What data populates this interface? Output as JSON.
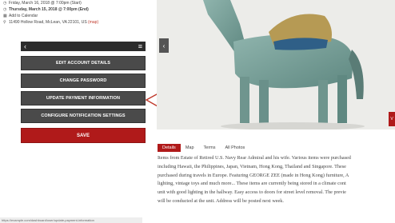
{
  "event": {
    "line1": "Friday, March 16, 2018 @ 7:00pm (Start)",
    "line2": "Thursday, March 15, 2018 @ 7:00pm (End)",
    "calendar_label": "Add to Calendar",
    "address": "11490 Hollow Road, McLean, VA 22101, US",
    "map_label": "(map)"
  },
  "menu": {
    "back_icon": "‹",
    "hamburger_icon": "≡",
    "edit_label": "EDIT ACCOUNT DETAILS",
    "password_label": "CHANGE PASSWORD",
    "payment_label": "UPDATE PAYMENT INFORMATION",
    "notifications_label": "CONFIGURE NOTIFICATION SETTINGS",
    "save_label": "SAVE"
  },
  "status_url": "https://example.com/dashboard/user/update-payment-information",
  "gallery": {
    "prev_icon": "‹",
    "next_label": "V"
  },
  "tabs": [
    "Details",
    "Map",
    "Terms",
    "All Photos"
  ],
  "details": {
    "lines": [
      "Items from Estate of Retired U.S. Navy Rear Admiral and his wife.  Various items were purchased",
      "including Hawaii, the Philippines, Japan, Vietnam, Hong Kong, Thailand and Singapore. These",
      "purchased during travels in Europe. Featuring GEORGE ZEE (made in Hong Kong) furniture, A",
      "lighting, vintage toys and much more...  These items are currently being stored in a climate cont",
      "unit with good lighting in the hallway.  Easy access to doors for street level removal.  The previe",
      "will be conducted at the unit.  Address will be posted next week."
    ]
  },
  "colors": {
    "accent": "#b01a1a",
    "menu_button": "#4a4a4a",
    "topbar": "#2b2b2b",
    "arrow_outline": "#c0392b"
  }
}
